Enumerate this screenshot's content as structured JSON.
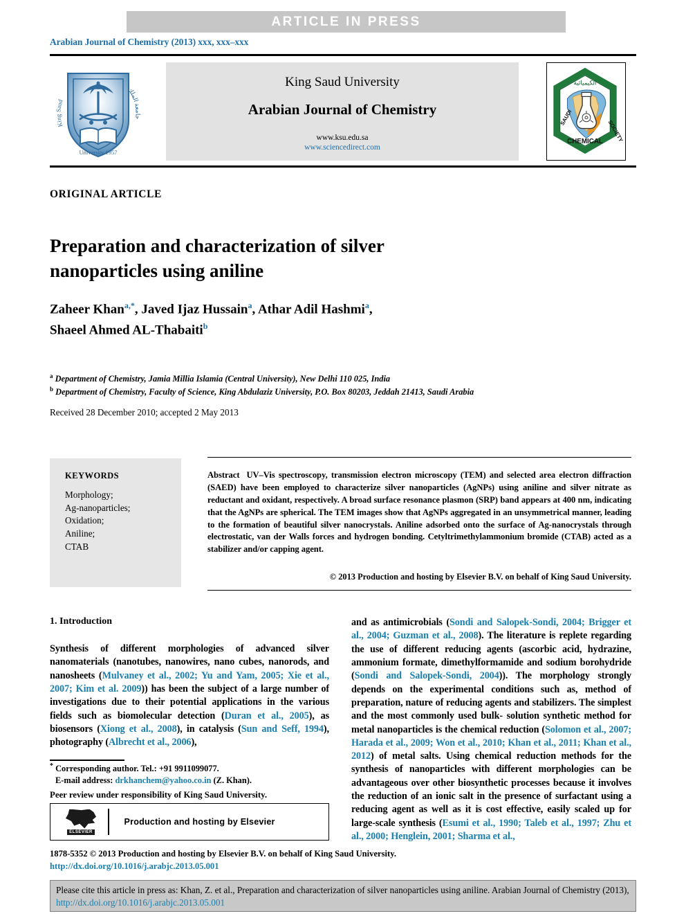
{
  "banner": {
    "text": "ARTICLE  IN  PRESS"
  },
  "journal_line": {
    "prefix": "Arabian Journal of Chemistry (2013) ",
    "volume": "xxx, xxx–xxx"
  },
  "masthead": {
    "university": "King Saud University",
    "journal": "Arabian Journal of Chemistry",
    "url_ksu": "www.ksu.edu.sa",
    "url_sciencedirect": "www.sciencedirect.com",
    "ksu_logo_alt": "King Saud University 1957",
    "scs_logo_alt": "Saudi Chemical Society"
  },
  "article_type": "ORIGINAL ARTICLE",
  "title": "Preparation and characterization of silver nanoparticles using aniline",
  "authors": [
    {
      "name": "Zaheer Khan",
      "marks": "a,*"
    },
    {
      "name": "Javed Ijaz Hussain",
      "marks": "a"
    },
    {
      "name": "Athar Adil Hashmi",
      "marks": "a"
    },
    {
      "name": "Shaeel Ahmed AL-Thabaiti",
      "marks": "b"
    }
  ],
  "affiliations": [
    {
      "mark": "a",
      "text": "Department of Chemistry, Jamia Millia Islamia (Central University), New Delhi 110 025, India"
    },
    {
      "mark": "b",
      "text": "Department of Chemistry, Faculty of Science, King Abdulaziz University, P.O. Box 80203, Jeddah 21413, Saudi Arabia"
    }
  ],
  "received": "Received 28 December 2010; accepted 2 May 2013",
  "keywords": {
    "heading": "KEYWORDS",
    "items": "Morphology;\nAg-nanoparticles;\nOxidation;\nAniline;\nCTAB"
  },
  "abstract": {
    "label": "Abstract",
    "body": "UV–Vis spectroscopy, transmission electron microscopy (TEM) and selected area electron diffraction (SAED) have been employed to characterize silver nanoparticles (AgNPs) using aniline and silver nitrate as reductant and oxidant, respectively. A broad surface resonance plasmon (SRP) band appears at 400 nm, indicating that the AgNPs are spherical. The TEM images show that AgNPs aggregated in an unsymmetrical manner, leading to the formation of beautiful silver nanocrystals. Aniline adsorbed onto the surface of Ag-nanocrystals through electrostatic, van der Walls forces and hydrogen bonding. Cetyltrimethylammonium bromide (CTAB) acted as a stabilizer and/or capping agent.",
    "copyright": "© 2013 Production and hosting by Elsevier B.V. on behalf of King Saud University."
  },
  "introduction": {
    "heading": "1. Introduction",
    "left_paragraph": {
      "p1": "Synthesis of different morphologies of advanced silver nanomaterials (nanotubes, nanowires, nano cubes, nanorods, and nanosheets (",
      "c1": "Mulvaney et al., 2002; Yu and Yam, 2005; Xie et al., 2007; Kim et al. 2009",
      "p2": ")) has been the subject of a large number of investigations due to their potential applications in the various fields such as biomolecular detection (",
      "c2": "Duran et al., 2005",
      "p3": "), as biosensors (",
      "c3": "Xiong et al., 2008",
      "p4": "), in catalysis (",
      "c4": "Sun and Seff, 1994",
      "p5": "), photography (",
      "c5": "Albrecht et al., 2006",
      "p6": "),"
    },
    "right_paragraph": {
      "p1": "and as antimicrobials (",
      "c1": "Sondi and Salopek-Sondi, 2004; Brigger et al., 2004; Guzman et al., 2008",
      "p2": "). The literature is replete regarding the use of different reducing agents (ascorbic acid, hydrazine, ammonium formate, dimethylformamide and sodium borohydride (",
      "c2": "Sondi and Salopek-Sondi, 2004",
      "p3": ")). The morphology strongly depends on the experimental conditions such as, method of preparation, nature of reducing agents and stabilizers. The simplest and the most commonly used bulk- solution synthetic method for metal nanoparticles is the chemical reduction (",
      "c3": "Solomon et al., 2007; Harada et al., 2009; Won et al., 2010; Khan et al., 2011; Khan et al., 2012",
      "p4": ") of metal salts. Using chemical reduction methods for the synthesis of nanoparticles with different morphologies can be advantageous over other biosynthetic processes because it involves the reduction of an ionic salt in the presence of surfactant using a reducing agent as well as it is cost effective, easily scaled up for large-scale synthesis (",
      "c4": "Esumi et al., 1990; Taleb et al., 1997; Zhu et al., 2000; Henglein, 2001; Sharma et al.,",
      "p5": ""
    }
  },
  "footnote": {
    "corresponding": "Corresponding author. Tel.: +91 9911099077.",
    "email_label": "E-mail address:",
    "email": "drkhanchem@yahoo.co.in",
    "email_suffix": "(Z. Khan).",
    "peer_review": "Peer review under responsibility of King Saud University."
  },
  "elsevier": {
    "wordmark": "ELSEVIER",
    "label": "Production and hosting by Elsevier"
  },
  "issn": {
    "line1": "1878-5352 © 2013 Production and hosting by Elsevier B.V. on behalf of King Saud University.",
    "doi": "http://dx.doi.org/10.1016/j.arabjc.2013.05.001"
  },
  "citation_footer": {
    "text_before": "Please cite this article in press as: Khan, Z. et al., Preparation and characterization of silver nanoparticles using aniline. Arabian Journal of Chemistry (2013), ",
    "doi": "http://dx.doi.org/10.1016/j.arabjc.2013.05.001"
  },
  "colors": {
    "link": "#1a7fad",
    "banner_bg": "#c6c6c6",
    "panel_bg": "#e6e6e6",
    "footer_bg": "#c8c8c8"
  }
}
